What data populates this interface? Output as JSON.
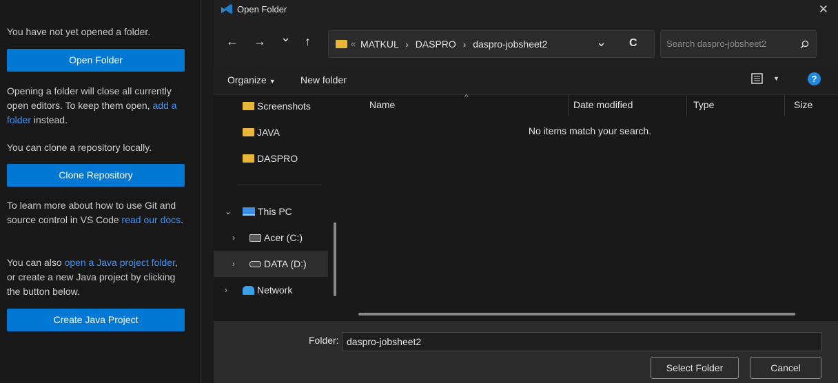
{
  "vscode": {
    "not_opened": "You have not yet opened a folder.",
    "open_folder": "Open Folder",
    "closing_1": "Opening a folder will close all currently open editors. To keep them open, ",
    "add_folder_link": "add a folder",
    "closing_2": " instead.",
    "clone_text": "You can clone a repository locally.",
    "clone_button": "Clone Repository",
    "git_1": "To learn more about how to use Git and source control in VS Code ",
    "read_docs_link": "read our docs",
    "git_2": ".",
    "java_1": "You can also ",
    "java_link": "open a Java project folder",
    "java_2": ", or create a new Java project by clicking the button below.",
    "create_java": "Create Java Project"
  },
  "dialog": {
    "title": "Open Folder",
    "close": "✕",
    "nav": {
      "back": "←",
      "forward": "→",
      "recent": "⌄",
      "up": "↑",
      "refresh": "C",
      "dropdown": "⌄"
    },
    "breadcrumb": [
      "MATKUL",
      "DASPRO",
      "daspro-jobsheet2"
    ],
    "breadcrumb_overflow": "«",
    "search_placeholder": "Search daspro-jobsheet2",
    "organize": "Organize",
    "new_folder": "New folder",
    "tree": [
      {
        "label": "Screenshots",
        "type": "folder"
      },
      {
        "label": "JAVA",
        "type": "folder"
      },
      {
        "label": "DASPRO",
        "type": "folder"
      },
      {
        "label": "This PC",
        "type": "pc",
        "expanded": true
      },
      {
        "label": "Acer (C:)",
        "type": "drive"
      },
      {
        "label": "DATA (D:)",
        "type": "drive",
        "selected": true
      },
      {
        "label": "Network",
        "type": "network"
      }
    ],
    "columns": [
      "Name",
      "Date modified",
      "Type",
      "Size"
    ],
    "empty_message": "No items match your search.",
    "folder_label": "Folder:",
    "folder_value": "daspro-jobsheet2",
    "select_button": "Select Folder",
    "cancel_button": "Cancel"
  },
  "colors": {
    "accent": "#0078d4",
    "link": "#3794ff",
    "folder": "#e8b73a"
  }
}
